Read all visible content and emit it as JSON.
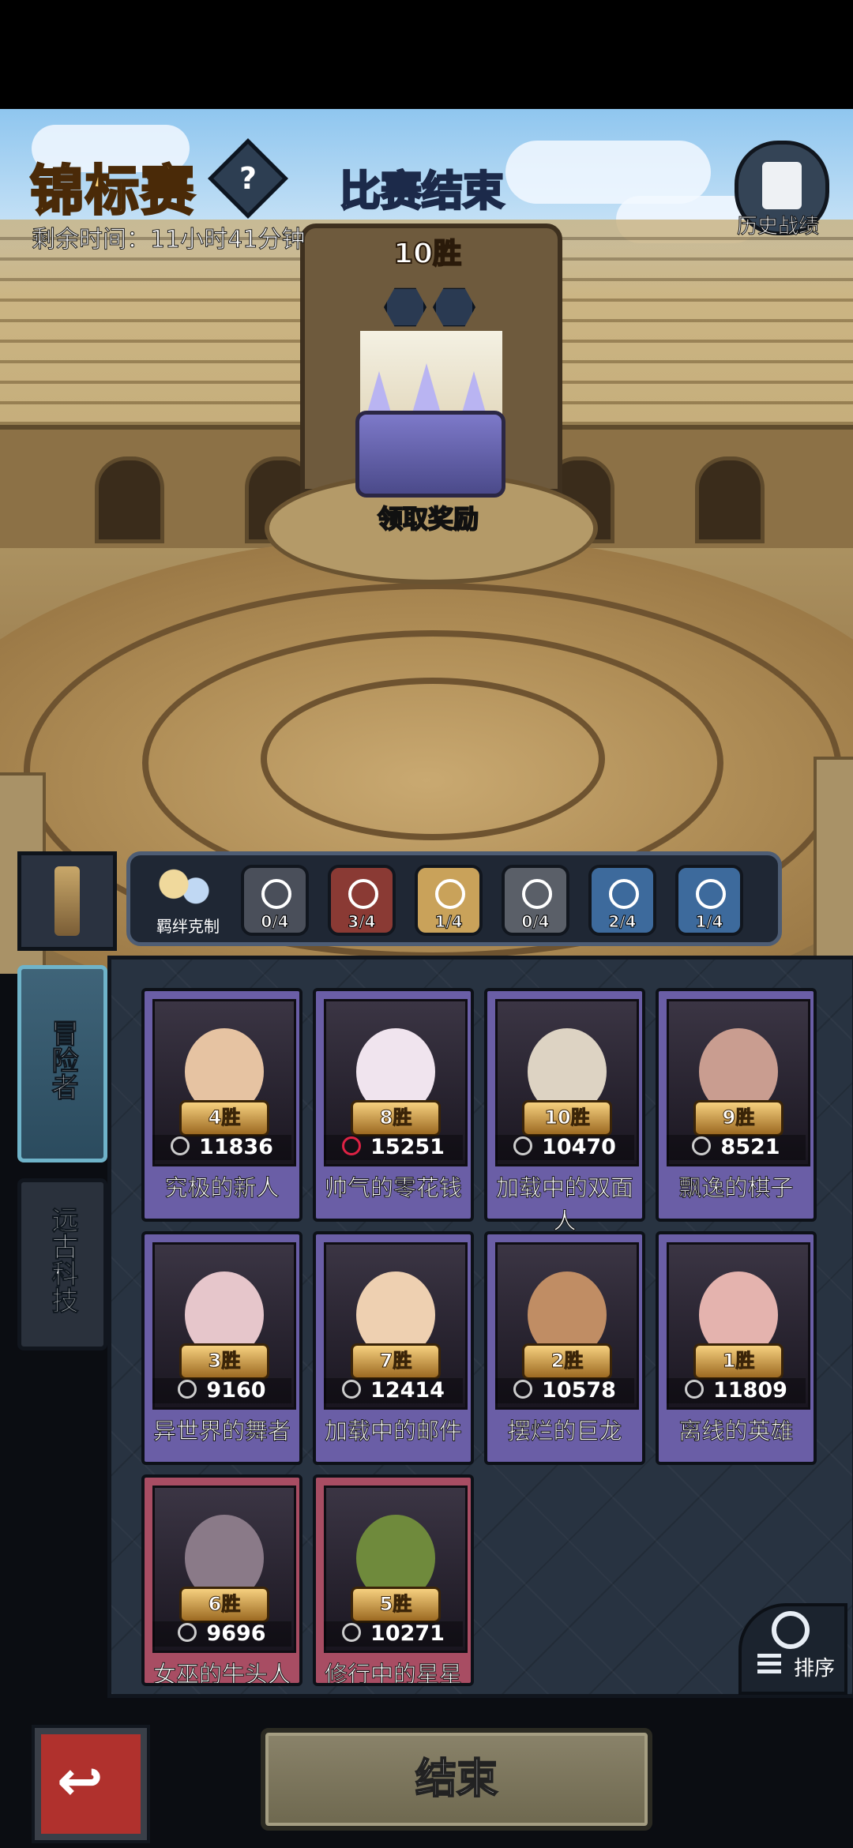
{
  "header": {
    "title": "锦标赛",
    "help_symbol": "?",
    "timer": "剩余时间：11小时41分钟",
    "match_status": "比赛结束",
    "wins": "10胜",
    "history_label": "历史战绩"
  },
  "reward": {
    "claim_label": "领取奖励"
  },
  "synergy": {
    "bond_label": "羁绊克制",
    "items": [
      {
        "count": "0/4",
        "color": "#4a4f5a"
      },
      {
        "count": "3/4",
        "color": "#8a3a34"
      },
      {
        "count": "1/4",
        "color": "#c9a25a"
      },
      {
        "count": "0/4",
        "color": "#5a5f68"
      },
      {
        "count": "2/4",
        "color": "#3d6a9c"
      },
      {
        "count": "1/4",
        "color": "#3d6a9c"
      }
    ]
  },
  "tabs": {
    "adventurer": "冒险者",
    "tech": "远古科技"
  },
  "roster": [
    {
      "wins": "4胜",
      "power": "11836",
      "name": "究极的新人",
      "frame": "purple"
    },
    {
      "wins": "8胜",
      "power": "15251",
      "name": "帅气的零花钱",
      "frame": "purple"
    },
    {
      "wins": "10胜",
      "power": "10470",
      "name": "加载中的双面人",
      "frame": "purple"
    },
    {
      "wins": "9胜",
      "power": "8521",
      "name": "飘逸的棋子",
      "frame": "purple"
    },
    {
      "wins": "3胜",
      "power": "9160",
      "name": "异世界的舞者",
      "frame": "purple"
    },
    {
      "wins": "7胜",
      "power": "12414",
      "name": "加载中的邮件",
      "frame": "purple"
    },
    {
      "wins": "2胜",
      "power": "10578",
      "name": "摆烂的巨龙",
      "frame": "purple"
    },
    {
      "wins": "1胜",
      "power": "11809",
      "name": "离线的英雄",
      "frame": "purple"
    },
    {
      "wins": "6胜",
      "power": "9696",
      "name": "女巫的牛头人",
      "frame": "red"
    },
    {
      "wins": "5胜",
      "power": "10271",
      "name": "修行中的星星",
      "frame": "red"
    }
  ],
  "sort_label": "排序",
  "footer": {
    "back_symbol": "↩",
    "end_label": "结束"
  }
}
